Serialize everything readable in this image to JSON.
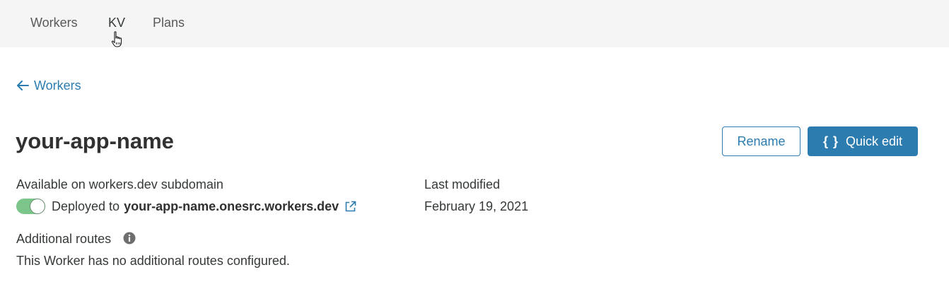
{
  "nav": {
    "items": [
      {
        "label": "Workers"
      },
      {
        "label": "KV"
      },
      {
        "label": "Plans"
      }
    ]
  },
  "back_link": {
    "label": "Workers"
  },
  "page": {
    "title": "your-app-name"
  },
  "buttons": {
    "rename": "Rename",
    "quick_edit_icon": "{ }",
    "quick_edit": "Quick edit"
  },
  "subdomain": {
    "label": "Available on workers.dev subdomain",
    "toggle_on": true,
    "deployed_prefix": "Deployed to",
    "domain": "your-app-name.onesrc.workers.dev"
  },
  "modified": {
    "label": "Last modified",
    "date": "February 19, 2021"
  },
  "routes": {
    "label": "Additional routes",
    "message": "This Worker has no additional routes configured."
  },
  "colors": {
    "accent": "#2c7cb0",
    "toggle_on": "#7cc58a",
    "nav_bg": "#f5f5f5",
    "text": "#36393a"
  },
  "icons": [
    "arrow-left-icon",
    "external-link-icon",
    "info-icon",
    "hand-pointer-icon"
  ]
}
